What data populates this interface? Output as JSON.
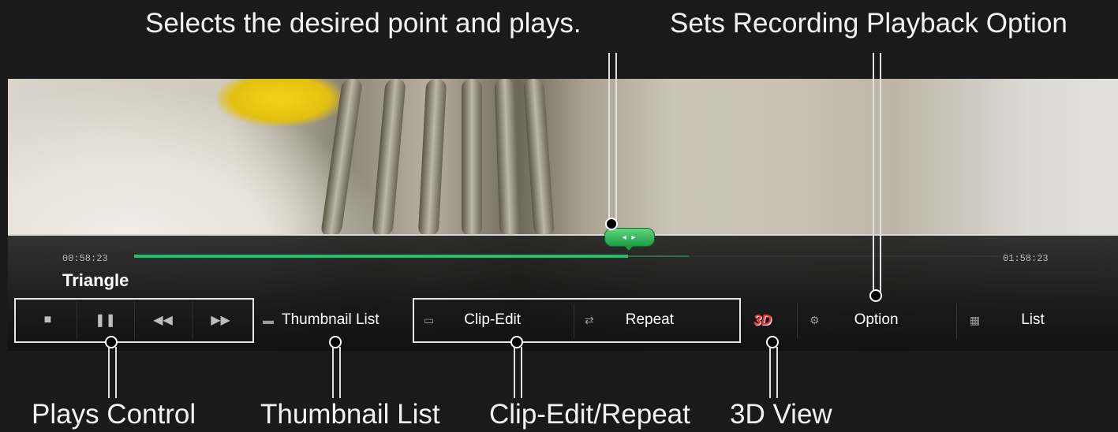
{
  "annotations": {
    "top_left": "Selects the desired point and plays.",
    "top_right": "Sets Recording Playback Option",
    "bottom": [
      "Plays Control",
      "Thumbnail List",
      "Clip-Edit/Repeat",
      "3D View"
    ]
  },
  "player": {
    "time_start": "00:58:23",
    "time_end": "01:58:23",
    "title": "Triangle",
    "progress_fraction": 0.57,
    "buffer_fraction": 0.64,
    "seek_marker": "◂ ▸"
  },
  "controls": {
    "stop": "■",
    "pause": "❚❚",
    "rewind": "◀◀",
    "fast_forward": "▶▶",
    "thumbnail_list": "Thumbnail List",
    "clip_edit": "Clip-Edit",
    "repeat": "Repeat",
    "three_d": "3D",
    "option": "Option",
    "list": "List"
  },
  "colors": {
    "progress": "#1dc16e",
    "seek_marker": "#2fb458",
    "three_d": "#ff3030"
  }
}
